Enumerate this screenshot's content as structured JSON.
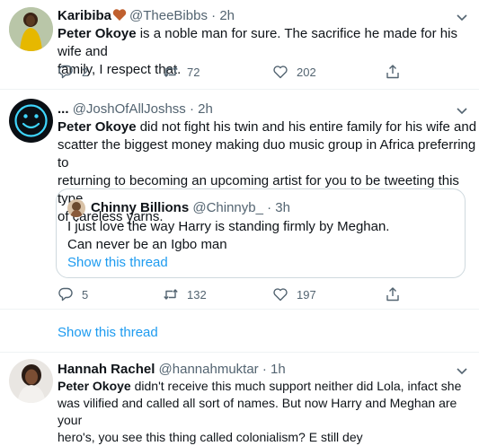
{
  "tweets": [
    {
      "display_name": "Karibiba",
      "handle": "@TheeBibbs",
      "time": "2h",
      "mention": "Peter Okoye",
      "text_line1_rest": " is a noble man for sure. The sacrifice he made for his wife and",
      "text_line2": "family, I respect that.",
      "replies": "2",
      "retweets": "72",
      "likes": "202"
    },
    {
      "display_name": "...",
      "handle": "@JoshOfAllJoshss",
      "time": "2h",
      "mention": "Peter Okoye",
      "text_line1_rest": " did not fight his twin and his entire family for his wife and",
      "text_line2": "scatter the biggest money making duo music group in Africa preferring to",
      "text_line3": "returning to becoming an upcoming artist for you to be tweeting this type",
      "text_line4": "of careless yarns.",
      "quote": {
        "display_name": "Chinny Billions",
        "handle": "@Chinnyb_",
        "time": "3h",
        "text_line1": "I just love the way Harry is standing firmly by Meghan.",
        "text_line2": "Can never be an Igbo man",
        "show_thread": "Show this thread"
      },
      "replies": "5",
      "retweets": "132",
      "likes": "197"
    },
    {
      "display_name": "Hannah Rachel",
      "handle": "@hannahmuktar",
      "time": "1h",
      "mention": "Peter Okoye",
      "text_line1_rest": " didn't receive this much support neither did Lola, infact she",
      "text_line2": "was vilified and called all sort of names. But now Harry and Meghan are your",
      "text_line3": "hero's, you see this thing called colonialism? E still dey"
    }
  ],
  "show_this_thread": "Show this thread",
  "separator": "·",
  "colors": {
    "accent": "#1d9bf0",
    "muted": "#536471",
    "heart_emoji": "#c0602e"
  },
  "icons": [
    "chevron-down-icon",
    "reply-icon",
    "retweet-icon",
    "like-icon",
    "share-icon",
    "heart-emoji-icon",
    "smiley-avatar"
  ]
}
